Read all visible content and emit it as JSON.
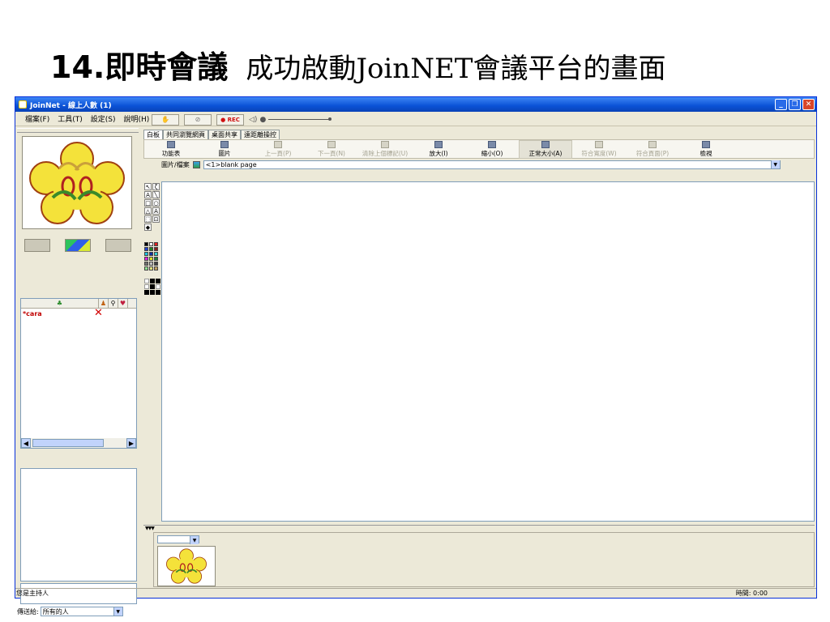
{
  "slide": {
    "title_bold": "14.即時會議",
    "title_rest": "成功啟動JoinNET會議平台的畫面"
  },
  "window": {
    "title": "JoinNet - 線上人數 (1)"
  },
  "menu": [
    "檔案(F)",
    "工具(T)",
    "設定(S)",
    "說明(H)"
  ],
  "quickbar": {
    "rec_label": "● REC"
  },
  "tabs": [
    "白板",
    "共同瀏覽網頁",
    "桌面共享",
    "遠距離操控"
  ],
  "toolbar": [
    {
      "label": "功能表",
      "state": "enabled"
    },
    {
      "label": "圖片",
      "state": "enabled"
    },
    {
      "label": "上一頁(P)",
      "state": "disabled"
    },
    {
      "label": "下一頁(N)",
      "state": "disabled"
    },
    {
      "label": "清除上個標記(U)",
      "state": "disabled"
    },
    {
      "label": "放大(I)",
      "state": "enabled"
    },
    {
      "label": "縮小(O)",
      "state": "enabled"
    },
    {
      "label": "正常大小(A)",
      "state": "active"
    },
    {
      "label": "符合寬度(W)",
      "state": "disabled"
    },
    {
      "label": "符合頁面(P)",
      "state": "disabled"
    },
    {
      "label": "檢視",
      "state": "enabled"
    }
  ],
  "address": {
    "label": "圖片/檔案",
    "value": "<1>blank page"
  },
  "users": [
    {
      "name": "*cara"
    }
  ],
  "send_to": {
    "label": "傳送給:",
    "value": "所有的人"
  },
  "status": {
    "left": "您是主持人",
    "right": "時間: 0:00"
  },
  "colors": {
    "titlebar": "#0a52d6",
    "window_bg": "#ece9d8",
    "user_name": "#c00000"
  }
}
